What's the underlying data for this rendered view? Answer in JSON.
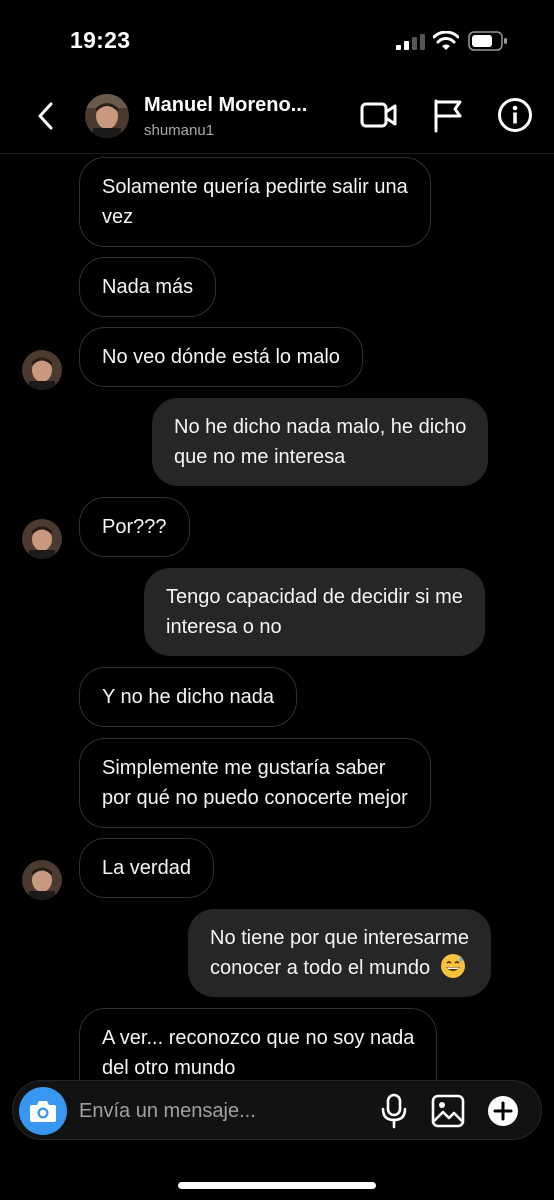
{
  "status_bar": {
    "time": "19:23"
  },
  "header": {
    "name": "Manuel Moreno...",
    "username": "shumanu1"
  },
  "messages": [
    {
      "side": "in",
      "text_lines": [
        "Solamente quería pedirte salir una",
        "vez"
      ]
    },
    {
      "side": "in",
      "text_lines": [
        "Nada más"
      ]
    },
    {
      "side": "in",
      "text_lines": [
        "No veo dónde está lo malo"
      ]
    },
    {
      "side": "out",
      "text_lines": [
        "No he dicho nada malo, he dicho",
        "que no me interesa"
      ]
    },
    {
      "side": "in",
      "text_lines": [
        "Por???"
      ]
    },
    {
      "side": "out",
      "text_lines": [
        "Tengo capacidad de decidir si me",
        "interesa o no"
      ]
    },
    {
      "side": "in",
      "text_lines": [
        "Y no he dicho nada"
      ]
    },
    {
      "side": "in",
      "text_lines": [
        "Simplemente me gustaría saber",
        "por qué no puedo conocerte mejor"
      ]
    },
    {
      "side": "in",
      "text_lines": [
        "La verdad"
      ]
    },
    {
      "side": "out",
      "text_lines": [
        "No tiene por que interesarme",
        "conocer a todo el mundo"
      ],
      "emoji": "grinning-sweat-emoji"
    },
    {
      "side": "in",
      "text_lines": [
        "A ver... reconozco que no soy nada",
        "del otro mundo"
      ]
    }
  ],
  "composer": {
    "placeholder": "Envía un mensaje..."
  },
  "colors": {
    "accent": "#3897f0",
    "outgoing_bubble": "#262626",
    "incoming_border": "#303030"
  }
}
